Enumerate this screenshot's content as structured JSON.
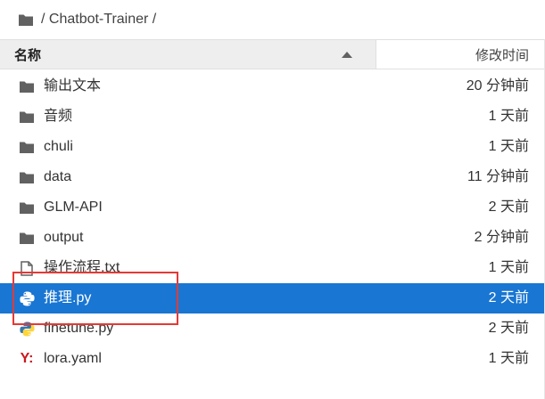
{
  "breadcrumb": {
    "icon": "folder-icon",
    "path": "/ Chatbot-Trainer /"
  },
  "header": {
    "name_label": "名称",
    "modified_label": "修改时间",
    "sort": "ascending"
  },
  "files": [
    {
      "name": "输出文本",
      "modified": "20 分钟前",
      "icon": "folder-icon",
      "selected": false
    },
    {
      "name": "音频",
      "modified": "1 天前",
      "icon": "folder-icon",
      "selected": false
    },
    {
      "name": "chuli",
      "modified": "1 天前",
      "icon": "folder-icon",
      "selected": false
    },
    {
      "name": "data",
      "modified": "11 分钟前",
      "icon": "folder-icon",
      "selected": false
    },
    {
      "name": "GLM-API",
      "modified": "2 天前",
      "icon": "folder-icon",
      "selected": false
    },
    {
      "name": "output",
      "modified": "2 分钟前",
      "icon": "folder-icon",
      "selected": false
    },
    {
      "name": "操作流程.txt",
      "modified": "1 天前",
      "icon": "text-file-icon",
      "selected": false
    },
    {
      "name": "推理.py",
      "modified": "2 天前",
      "icon": "python-file-icon",
      "selected": true
    },
    {
      "name": "finetune.py",
      "modified": "2 天前",
      "icon": "python-file-icon",
      "selected": false
    },
    {
      "name": "lora.yaml",
      "modified": "1 天前",
      "icon": "yaml-file-icon",
      "selected": false
    }
  ],
  "colors": {
    "selection": "#1976d2",
    "highlight_box": "#e53935",
    "folder": "#616161"
  }
}
